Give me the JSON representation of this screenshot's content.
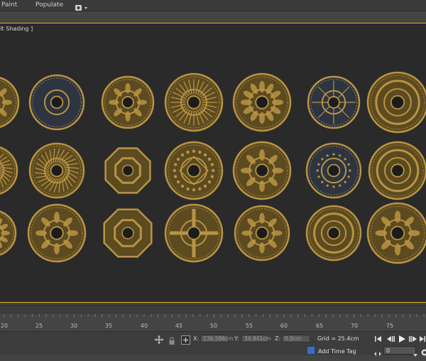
{
  "menu": {
    "paint_label": "Paint",
    "populate_label": "Populate"
  },
  "viewport": {
    "label": "ılt Shading ]",
    "border_color": "#d8b21a",
    "background_color": "#2a2a2a"
  },
  "gallery": {
    "item_count": 21,
    "metal_color": "#b89443",
    "shadow_color": "#5c4a20",
    "dark_panel_color": "#2e3440"
  },
  "timeline": {
    "ticks": [
      "20",
      "25",
      "30",
      "35",
      "40",
      "45",
      "50",
      "55",
      "60",
      "65",
      "70",
      "75"
    ]
  },
  "status": {
    "x_label": "X:",
    "x_value": "236.586cm",
    "y_label": "Y:",
    "y_value": "34.941cm",
    "z_label": "Z:",
    "z_value": "0.0cm",
    "grid": "Grid = 25.4cm",
    "time_tag": "Add Time Tag",
    "frame_value": "0"
  },
  "icons": {
    "camera": "camera-icon",
    "play": "play-icon",
    "prev_key": "prev-key-icon",
    "next_key": "next-key-icon",
    "go_start": "go-to-start-icon",
    "go_end": "go-to-end-icon",
    "selection_lock": "lock-icon",
    "transform": "transform-gizmo-icon",
    "absolute_mode": "absolute-mode-icon"
  }
}
